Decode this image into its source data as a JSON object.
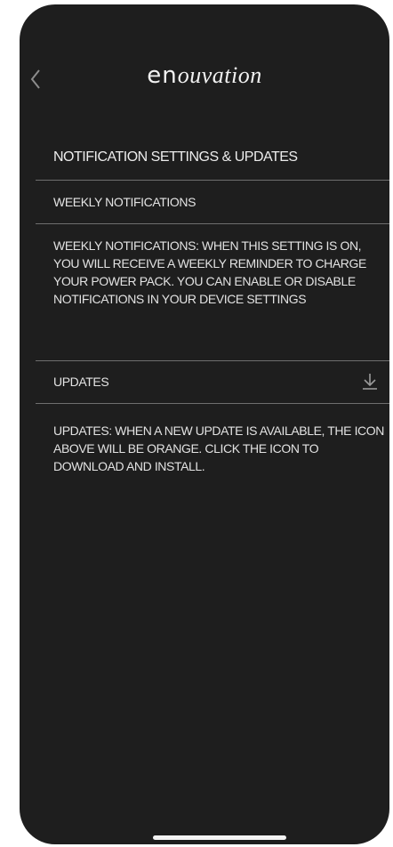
{
  "header": {
    "back_icon": "chevron-left-icon",
    "logo_prefix": "en",
    "logo_suffix": "ouvation"
  },
  "section_title": "NOTIFICATION SETTINGS & UPDATES",
  "weekly": {
    "label": "WEEKLY NOTIFICATIONS",
    "description": "WEEKLY NOTIFICATIONS:  WHEN THIS SETTING IS ON, YOU WILL RECEIVE A WEEKLY REMINDER TO CHARGE YOUR POWER PACK.  YOU CAN ENABLE OR DISABLE NOTIFICATIONS IN YOUR DEVICE SETTINGS"
  },
  "updates": {
    "label": "UPDATES",
    "icon": "download-icon",
    "description": "UPDATES:  WHEN A NEW UPDATE IS AVAILABLE, THE ICON ABOVE WILL BE ORANGE.  CLICK THE ICON TO DOWNLOAD AND INSTALL."
  },
  "colors": {
    "background": "#1e1e1e",
    "text": "#e8e8e8",
    "divider": "#6e6e6e",
    "icon_idle": "#9a9a9a"
  }
}
